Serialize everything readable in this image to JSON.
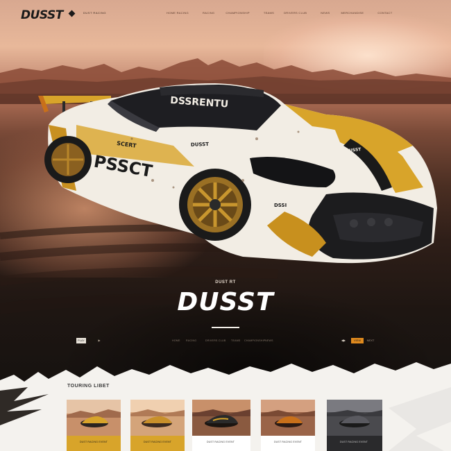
{
  "nav": {
    "logo": "DUSST",
    "tag": "DUST RACING",
    "links": [
      "HOME RACING",
      "RACING",
      "CHAMPIONSHIP",
      "TEAMS",
      "DRIVERS CLUB",
      "NEWS",
      "MERCHANDISE",
      "CONTACT"
    ]
  },
  "car": {
    "windshield_text": "DSSRENTU",
    "door_text": "PSSCT",
    "side_text": "SCERT",
    "decal_text": "DUSST",
    "hood_text": "DUSST",
    "front_badge": "DSSI"
  },
  "hero": {
    "kicker": "DUST RT",
    "title": "DUSST"
  },
  "controls": {
    "left_button": "PLAY",
    "left_icon": "share-icon",
    "left_text": [
      "HOME",
      "RACING",
      "DRIVERS CLUB",
      "TEAMS",
      "CHAMPIONSHIP",
      "NEWS"
    ],
    "right_prev": "prev-icon",
    "right_button": "VIEW",
    "right_text": "NEXT"
  },
  "section": {
    "title": "TOURING LIBET"
  },
  "cards": [
    {
      "line": "DUST RACING EVENT"
    },
    {
      "line": "DUST RACING EVENT"
    },
    {
      "line": "DUST RACING EVENT"
    },
    {
      "line": "DUST RACING EVENT"
    },
    {
      "line": "DUST RACING EVENT"
    }
  ],
  "colors": {
    "accent": "#e08a1e",
    "car_yellow": "#d8a42a",
    "car_white": "#f2ede4",
    "dark": "#1a1410"
  }
}
